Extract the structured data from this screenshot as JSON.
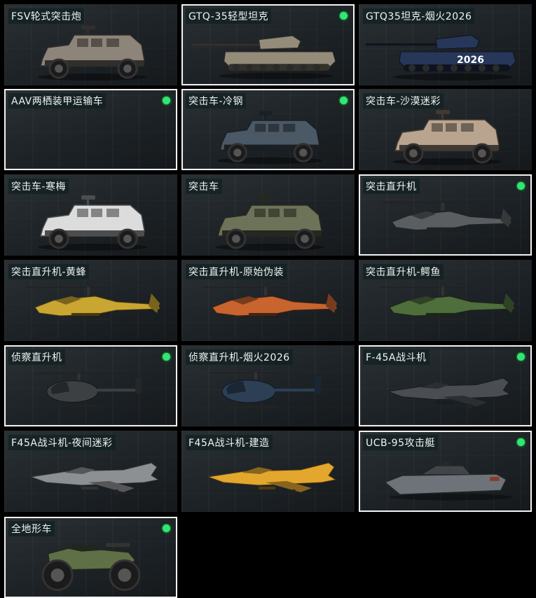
{
  "vehicles": [
    {
      "name": "FSV轮式突击炮",
      "kind": "truck",
      "selected": false,
      "dot": false,
      "color": "#8e857a"
    },
    {
      "name": "GTQ-35轻型坦克",
      "kind": "tank",
      "selected": true,
      "dot": true,
      "color": "#948b79"
    },
    {
      "name": "GTQ35坦克-烟火2026",
      "kind": "tank",
      "selected": false,
      "dot": false,
      "color": "#27375a",
      "badge": "2026"
    },
    {
      "name": "AAV两栖装甲运输车",
      "kind": "empty",
      "selected": true,
      "dot": true,
      "color": "#000000"
    },
    {
      "name": "突击车-冷钢",
      "kind": "truck",
      "selected": true,
      "dot": true,
      "color": "#4b5866"
    },
    {
      "name": "突击车-沙漠迷彩",
      "kind": "truck",
      "selected": false,
      "dot": false,
      "color": "#b9a48f"
    },
    {
      "name": "突击车-寒梅",
      "kind": "truck",
      "selected": false,
      "dot": false,
      "color": "#dcdcdc"
    },
    {
      "name": "突击车",
      "kind": "truck",
      "selected": false,
      "dot": false,
      "color": "#6c7359"
    },
    {
      "name": "突击直升机",
      "kind": "heli",
      "selected": true,
      "dot": true,
      "color": "#5a5e60"
    },
    {
      "name": "突击直升机-黄蜂",
      "kind": "heli",
      "selected": false,
      "dot": false,
      "color": "#c9a531"
    },
    {
      "name": "突击直升机-原始伪装",
      "kind": "heli",
      "selected": false,
      "dot": false,
      "color": "#c8642e"
    },
    {
      "name": "突击直升机-鳄鱼",
      "kind": "heli",
      "selected": false,
      "dot": false,
      "color": "#4e6e3c"
    },
    {
      "name": "侦察直升机",
      "kind": "scout",
      "selected": true,
      "dot": true,
      "color": "#3c4042"
    },
    {
      "name": "侦察直升机-烟火2026",
      "kind": "scout",
      "selected": false,
      "dot": false,
      "color": "#2c3f55"
    },
    {
      "name": "F-45A战斗机",
      "kind": "jet",
      "selected": true,
      "dot": true,
      "color": "#4a4e52"
    },
    {
      "name": "F45A战斗机-夜间迷彩",
      "kind": "jet",
      "selected": false,
      "dot": false,
      "color": "#8d9092"
    },
    {
      "name": "F45A战斗机-建造",
      "kind": "jet",
      "selected": false,
      "dot": false,
      "color": "#e3a72e"
    },
    {
      "name": "UCB-95攻击艇",
      "kind": "boat",
      "selected": true,
      "dot": true,
      "color": "#6d7378"
    },
    {
      "name": "全地形车",
      "kind": "atv",
      "selected": true,
      "dot": true,
      "color": "#5f7046"
    }
  ]
}
